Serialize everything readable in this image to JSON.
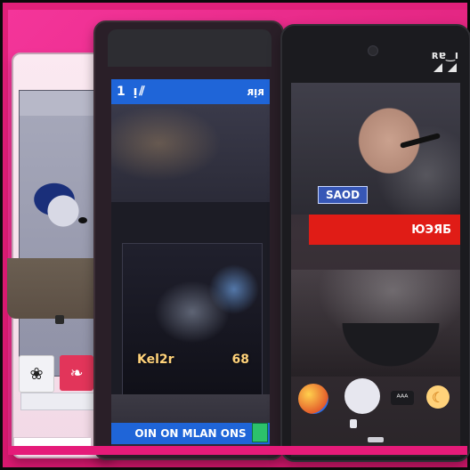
{
  "center_phone": {
    "status_left": "1 ᴉ⫽",
    "status_right": "ᴙᴉᴙ",
    "media_caption_left": "Kel2r",
    "media_caption_right": "68",
    "bottom_label": "OIN ON MLAN ONS"
  },
  "right_phone": {
    "status_text": "ʀɐ‿ı",
    "name_chip": "SAOD",
    "banner_text": "ЮЭЯБ",
    "chip_text": "ᴬᴬᴬ"
  },
  "left_phone": {
    "left_button_icon": "❀",
    "right_button_icon": "❧"
  },
  "colors": {
    "background": "#e1247f",
    "blue_bar": "#1f65d8",
    "red_banner": "#e01c16"
  },
  "icons": {
    "status_signal": "signal-icon",
    "status_battery": "battery-icon",
    "media_play": "media-icon",
    "emoji_globe": "globe-icon",
    "emoji_face": "face-icon",
    "emoji_moon": "moon-icon"
  }
}
